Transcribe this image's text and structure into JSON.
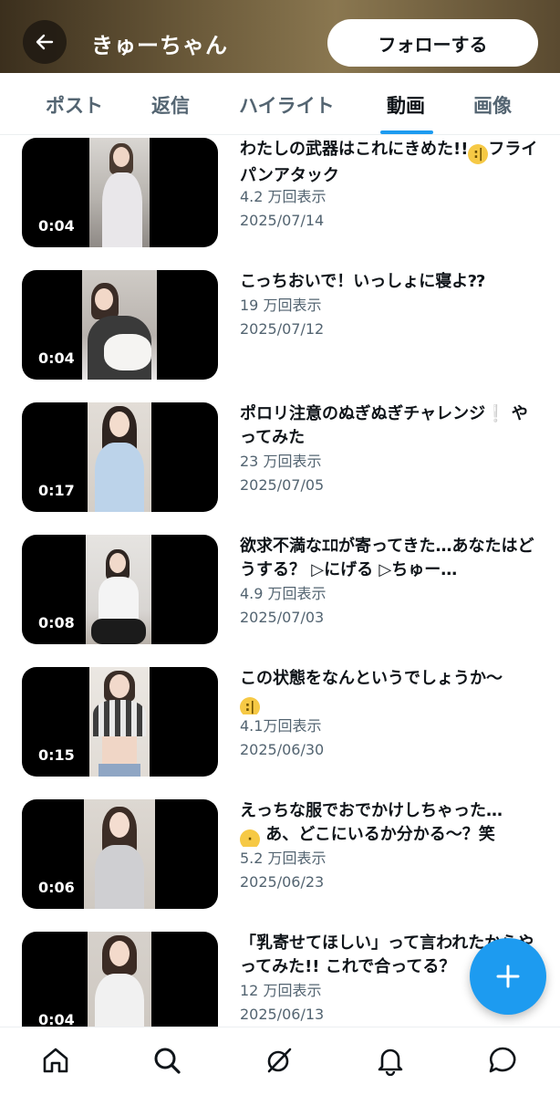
{
  "header": {
    "title": "きゅーちゃん",
    "follow_label": "フォローする",
    "back_icon": "arrow-left-icon"
  },
  "tabs": [
    {
      "label": "ポスト",
      "active": false
    },
    {
      "label": "返信",
      "active": false
    },
    {
      "label": "ハイライト",
      "active": false
    },
    {
      "label": "動画",
      "active": true
    },
    {
      "label": "画像",
      "active": false
    }
  ],
  "videos": [
    {
      "duration": "0:04",
      "title": "わたしの武器はこれにきめた!!",
      "title_after": "フライパンアタック",
      "emoji": "neutral-face",
      "views": "4.2 万回表示",
      "date": "2025/07/14"
    },
    {
      "duration": "0:04",
      "title": "こっちおいで！いっしょに寝よ⁇",
      "title_after": "",
      "emoji": "",
      "views": "19 万回表示",
      "date": "2025/07/12"
    },
    {
      "duration": "0:17",
      "title": "ポロリ注意のぬぎぬぎチャレンジ",
      "title_after": "❕ やってみた",
      "emoji": "",
      "views": "23 万回表示",
      "date": "2025/07/05"
    },
    {
      "duration": "0:08",
      "title": "欲求不満なｴﾛが寄ってきた…あなたはどうする？ ▷にげる ▷ちゅー…",
      "title_after": "",
      "emoji": "",
      "views": "4.9 万回表示",
      "date": "2025/07/03"
    },
    {
      "duration": "0:15",
      "title": "この状態をなんというでしょうか〜",
      "title_after": "",
      "emoji": "neutral-face",
      "views": "4.1万回表示",
      "date": "2025/06/30"
    },
    {
      "duration": "0:06",
      "title": "えっちな服でおでかけしちゃった…",
      "title_after": "あ、どこにいるか分かる〜？笑",
      "emoji": "shushing-face",
      "views": "5.2 万回表示",
      "date": "2025/06/23"
    },
    {
      "duration": "0:04",
      "title": "「乳寄せてほしい」って言われたからやってみた!! これで合ってる？",
      "title_after": "",
      "emoji": "",
      "views": "12 万回表示",
      "date": "2025/06/13"
    }
  ],
  "fab": {
    "icon": "plus-icon"
  },
  "bottom_nav": [
    {
      "icon": "home-icon"
    },
    {
      "icon": "search-icon"
    },
    {
      "icon": "grok-icon"
    },
    {
      "icon": "bell-icon"
    },
    {
      "icon": "message-icon"
    }
  ],
  "colors": {
    "accent": "#1d9bf0",
    "text_primary": "#0f1419",
    "text_secondary": "#536471"
  }
}
